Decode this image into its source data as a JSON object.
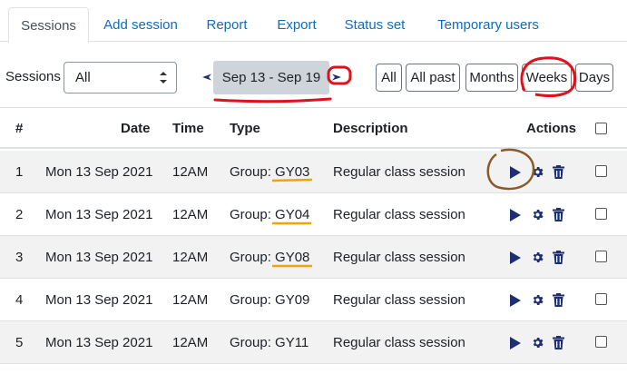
{
  "tabs": [
    {
      "label": "Sessions",
      "active": true
    },
    {
      "label": "Add session"
    },
    {
      "label": "Report"
    },
    {
      "label": "Export"
    },
    {
      "label": "Status set"
    },
    {
      "label": "Temporary users"
    }
  ],
  "filter": {
    "sessions_label": "Sessions",
    "select_value": "All",
    "date_range": "Sep 13 - Sep 19",
    "view_buttons": [
      "All",
      "All past",
      "Months",
      "Weeks",
      "Days"
    ]
  },
  "table": {
    "headers": {
      "num": "#",
      "date": "Date",
      "time": "Time",
      "type": "Type",
      "description": "Description",
      "actions": "Actions"
    },
    "rows": [
      {
        "num": "1",
        "date": "Mon 13 Sep 2021",
        "time": "12AM",
        "type_prefix": "Group: ",
        "group": "GY03",
        "description": "Regular class session"
      },
      {
        "num": "2",
        "date": "Mon 13 Sep 2021",
        "time": "12AM",
        "type_prefix": "Group: ",
        "group": "GY04",
        "description": "Regular class session"
      },
      {
        "num": "3",
        "date": "Mon 13 Sep 2021",
        "time": "12AM",
        "type_prefix": "Group: ",
        "group": "GY08",
        "description": "Regular class session"
      },
      {
        "num": "4",
        "date": "Mon 13 Sep 2021",
        "time": "12AM",
        "type_prefix": "Group: ",
        "group": "GY09",
        "description": "Regular class session"
      },
      {
        "num": "5",
        "date": "Mon 13 Sep 2021",
        "time": "12AM",
        "type_prefix": "Group: ",
        "group": "GY11",
        "description": "Regular class session"
      }
    ]
  },
  "colors": {
    "link": "#0f6cbf",
    "icon": "#1d2f6f",
    "annotation_red": "#e0101c",
    "annotation_orange": "#f0a30a",
    "annotation_brown": "#8b5a2b"
  }
}
